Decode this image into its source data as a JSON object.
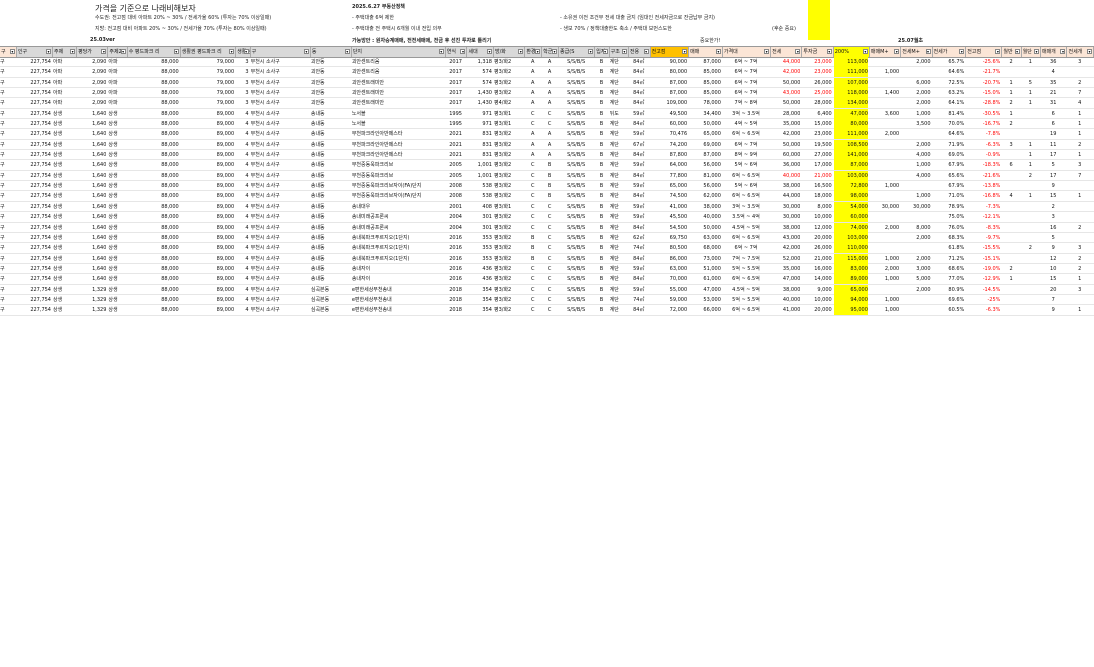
{
  "header_notes": {
    "title": "가격을 기준으로 나래비해보자",
    "line1": "수도권: 전고점 대비 아파트 20% ~ 30% / 전세가율 60% (투자는 70% 이상일때)",
    "line2": "지방: 전고점 대비 아파트 20% ~ 30% / 전세가율 70% (투자는 80% 이상일때)",
    "date": "2025.6.27 부동산정책",
    "policy1": "- 주택대출 6억 제한",
    "policy2": "- 주택대출 전 주택시 6개월 이내 전입 의무",
    "policy3": "- 소유권 이전 조건부 전세 대출 금지 (임대인 전세자금으로 잔금납부 금지)",
    "policy4": "- 생보 70% / 정책대출한도 축소 / 주택대 보먼스도한",
    "policy5": "(후순 중요)",
    "left_marker": "25.03ver",
    "mid_marker": "가능방안 : 원자승계매매, 전전세매매, 전금 후 선진 투자로 틀리기",
    "sell_label": "중요한가!",
    "right_marker": "25.07월초"
  },
  "columns": [
    {
      "label": "구",
      "style": "peach"
    },
    {
      "label": "인구",
      "style": "gray"
    },
    {
      "label": "주제",
      "style": "gray"
    },
    {
      "label": "평당가",
      "style": "gray"
    },
    {
      "label": "주제2",
      "style": "gray"
    },
    {
      "label": "수 평드파크 리",
      "style": "gray"
    },
    {
      "label": "생활권 평드파크 리",
      "style": "gray"
    },
    {
      "label": "생활권",
      "style": "gray"
    },
    {
      "label": "구",
      "style": "gray"
    },
    {
      "label": "동",
      "style": "gray"
    },
    {
      "label": "단지",
      "style": "gray"
    },
    {
      "label": "연식",
      "style": "gray"
    },
    {
      "label": "세대",
      "style": "gray"
    },
    {
      "label": "방/화",
      "style": "gray"
    },
    {
      "label": "환경",
      "style": "gray"
    },
    {
      "label": "학군",
      "style": "gray"
    },
    {
      "label": "종급(S",
      "style": "gray"
    },
    {
      "label": "입지",
      "style": "gray"
    },
    {
      "label": "구조",
      "style": "gray"
    },
    {
      "label": "전용",
      "style": "gray"
    },
    {
      "label": "전고점",
      "style": "orange"
    },
    {
      "label": "매매",
      "style": "peach"
    },
    {
      "label": "가격대",
      "style": "peach"
    },
    {
      "label": "전세",
      "style": "peach"
    },
    {
      "label": "투자금",
      "style": "peach"
    },
    {
      "label": "200%",
      "style": "yellow"
    },
    {
      "label": "매매M+",
      "style": "peach"
    },
    {
      "label": "전세M+",
      "style": "peach"
    },
    {
      "label": "전세가",
      "style": "peach"
    },
    {
      "label": "전고점",
      "style": "peach"
    },
    {
      "label": "월반",
      "style": "peach"
    },
    {
      "label": "월단",
      "style": "peach"
    },
    {
      "label": "매매개",
      "style": "peach"
    },
    {
      "label": "전세개",
      "style": "peach"
    }
  ],
  "rows": [
    [
      "구",
      "227,754",
      "아파",
      "2,090",
      "아파",
      "88,000",
      "79,000",
      "3",
      "부천시 소사구",
      "괴안동",
      "괴안센트리움",
      "2017",
      "1,318",
      "평3/화2",
      "A",
      "A",
      "S/S/B/S",
      "B",
      "계단",
      "84㎡",
      "90,000",
      "87,000",
      "6억 ~ 7억",
      "44,000",
      "23,000",
      "113,000",
      "",
      "2,000",
      "65.7%",
      "-25.6%",
      "2",
      "1",
      "36",
      "3"
    ],
    [
      "구",
      "227,754",
      "아파",
      "2,090",
      "아파",
      "88,000",
      "79,000",
      "3",
      "부천시 소사구",
      "괴안동",
      "괴안센트리움",
      "2017",
      "574",
      "평3/화2",
      "A",
      "A",
      "S/S/B/S",
      "B",
      "계단",
      "84㎡",
      "80,000",
      "85,000",
      "6억 ~ 7억",
      "42,000",
      "23,000",
      "111,000",
      "1,000",
      "",
      "64.6%",
      "-21.7%",
      "",
      "",
      "4",
      ""
    ],
    [
      "구",
      "227,754",
      "아파",
      "2,090",
      "아파",
      "88,000",
      "79,000",
      "3",
      "부천시 소사구",
      "괴안동",
      "괴안센트래미안",
      "2017",
      "574",
      "평3/화2",
      "A",
      "A",
      "S/S/B/S",
      "B",
      "계단",
      "84㎡",
      "87,000",
      "85,000",
      "6억 ~ 7억",
      "50,000",
      "26,000",
      "107,000",
      "",
      "6,000",
      "72.5%",
      "-20.7%",
      "1",
      "5",
      "35",
      "2"
    ],
    [
      "구",
      "227,754",
      "아파",
      "2,090",
      "아파",
      "88,000",
      "79,000",
      "3",
      "부천시 소사구",
      "괴안동",
      "괴안센트래미안",
      "2017",
      "1,430",
      "평3/화2",
      "A",
      "A",
      "S/S/B/S",
      "B",
      "계단",
      "84㎡",
      "87,000",
      "85,000",
      "6억 ~ 7억",
      "43,000",
      "25,000",
      "118,000",
      "1,400",
      "2,000",
      "63.2%",
      "-15.0%",
      "1",
      "1",
      "21",
      "7"
    ],
    [
      "구",
      "227,754",
      "아파",
      "2,090",
      "아파",
      "88,000",
      "79,000",
      "3",
      "부천시 소사구",
      "괴안동",
      "괴안센트래미안",
      "2017",
      "1,430",
      "평4/화2",
      "A",
      "A",
      "S/S/B/S",
      "B",
      "계단",
      "84㎡",
      "109,000",
      "78,000",
      "7억 ~ 8억",
      "50,000",
      "28,000",
      "134,000",
      "",
      "2,000",
      "64.1%",
      "-28.8%",
      "2",
      "1",
      "31",
      "4"
    ],
    [
      "구",
      "227,754",
      "상생",
      "1,640",
      "상생",
      "88,000",
      "89,000",
      "4",
      "부천시 소사구",
      "송내동",
      "노서블",
      "1995",
      "971",
      "평3/화1",
      "C",
      "C",
      "S/S/B/S",
      "B",
      "뒤도",
      "59㎡",
      "49,500",
      "34,400",
      "3억 ~ 3.5억",
      "28,000",
      "6,400",
      "47,000",
      "3,600",
      "1,000",
      "81.4%",
      "-30.5%",
      "1",
      "",
      "6",
      "1"
    ],
    [
      "구",
      "227,754",
      "상생",
      "1,640",
      "상생",
      "88,000",
      "89,000",
      "4",
      "부천시 소사구",
      "송내동",
      "노서블",
      "1995",
      "971",
      "평3/화1",
      "C",
      "C",
      "S/S/B/S",
      "B",
      "계단",
      "84㎡",
      "60,000",
      "50,000",
      "4억 ~ 5억",
      "35,000",
      "15,000",
      "80,000",
      "",
      "3,500",
      "70.0%",
      "-16.7%",
      "2",
      "",
      "6",
      "1"
    ],
    [
      "구",
      "227,754",
      "상생",
      "1,640",
      "상생",
      "88,000",
      "89,000",
      "4",
      "부천시 소사구",
      "송내동",
      "부천파크라인아반떼스타",
      "2021",
      "831",
      "평3/화2",
      "A",
      "A",
      "S/S/B/S",
      "B",
      "계단",
      "59㎡",
      "70,476",
      "65,000",
      "6억 ~ 6.5억",
      "42,000",
      "23,000",
      "111,000",
      "2,000",
      "",
      "64.6%",
      "-7.8%",
      "",
      "",
      "19",
      "1"
    ],
    [
      "구",
      "227,754",
      "상생",
      "1,640",
      "상생",
      "88,000",
      "89,000",
      "4",
      "부천시 소사구",
      "송내동",
      "부천파크라인아반떼스타",
      "2021",
      "831",
      "평3/화2",
      "A",
      "A",
      "S/S/B/S",
      "B",
      "계단",
      "67㎡",
      "74,200",
      "69,000",
      "6억 ~ 7억",
      "50,000",
      "19,500",
      "108,500",
      "",
      "2,000",
      "71.9%",
      "-6.3%",
      "3",
      "1",
      "11",
      "2"
    ],
    [
      "구",
      "227,754",
      "상생",
      "1,640",
      "상생",
      "88,000",
      "89,000",
      "4",
      "부천시 소사구",
      "송내동",
      "부천파크라인아반떼스타",
      "2021",
      "831",
      "평3/화2",
      "A",
      "A",
      "S/S/B/S",
      "B",
      "계단",
      "84㎡",
      "87,800",
      "87,000",
      "8억 ~ 9억",
      "60,000",
      "27,000",
      "141,000",
      "",
      "4,000",
      "69.0%",
      "-0.9%",
      "",
      "1",
      "17",
      "1"
    ],
    [
      "구",
      "227,754",
      "상생",
      "1,640",
      "상생",
      "88,000",
      "89,000",
      "4",
      "부천시 소사구",
      "송내동",
      "부천중동욱파크리브",
      "2005",
      "1,001",
      "평3/화2",
      "C",
      "B",
      "S/S/B/S",
      "B",
      "계단",
      "59㎡",
      "64,000",
      "56,000",
      "5억 ~ 6억",
      "36,000",
      "17,000",
      "87,000",
      "",
      "1,000",
      "67.9%",
      "-18.3%",
      "6",
      "1",
      "5",
      "3"
    ],
    [
      "구",
      "227,754",
      "상생",
      "1,640",
      "상생",
      "88,000",
      "89,000",
      "4",
      "부천시 소사구",
      "송내동",
      "부천중동욱파크리브",
      "2005",
      "1,001",
      "평3/화2",
      "C",
      "B",
      "S/S/B/S",
      "B",
      "계단",
      "84㎡",
      "77,800",
      "81,000",
      "6억 ~ 6.5억",
      "40,000",
      "21,000",
      "103,000",
      "",
      "4,000",
      "65.6%",
      "-21.6%",
      "",
      "2",
      "17",
      "7"
    ],
    [
      "구",
      "227,754",
      "상생",
      "1,640",
      "상생",
      "88,000",
      "89,000",
      "4",
      "부천시 소사구",
      "송내동",
      "부천중동욱파크리브자이(FA)단지",
      "2008",
      "538",
      "평3/화2",
      "C",
      "B",
      "S/S/B/S",
      "B",
      "계단",
      "59㎡",
      "65,000",
      "56,000",
      "5억 ~ 6억",
      "38,000",
      "16,500",
      "72,800",
      "1,000",
      "",
      "67.9%",
      "-13.8%",
      "",
      "",
      "9",
      ""
    ],
    [
      "구",
      "227,754",
      "상생",
      "1,640",
      "상생",
      "88,000",
      "89,000",
      "4",
      "부천시 소사구",
      "송내동",
      "부천중동욱파크리브자이(FA)단지",
      "2008",
      "538",
      "평3/화2",
      "C",
      "B",
      "S/S/B/S",
      "B",
      "계단",
      "84㎡",
      "74,500",
      "62,000",
      "6억 ~ 6.5억",
      "44,000",
      "18,000",
      "98,000",
      "",
      "1,000",
      "71.0%",
      "-16.8%",
      "4",
      "1",
      "15",
      "1"
    ],
    [
      "구",
      "227,754",
      "상생",
      "1,640",
      "상생",
      "88,000",
      "89,000",
      "4",
      "부천시 소사구",
      "송내동",
      "송내대우",
      "2001",
      "408",
      "평3/화1",
      "C",
      "C",
      "S/S/B/S",
      "B",
      "계단",
      "59㎡",
      "41,000",
      "38,000",
      "3억 ~ 3.5억",
      "30,000",
      "8,000",
      "54,000",
      "30,000",
      "30,000",
      "78.9%",
      "-7.3%",
      "",
      "",
      "2",
      ""
    ],
    [
      "구",
      "227,754",
      "상생",
      "1,640",
      "상생",
      "88,000",
      "89,000",
      "4",
      "부천시 소사구",
      "송내동",
      "송내미래공프론씨",
      "2004",
      "301",
      "평3/화2",
      "C",
      "C",
      "S/S/B/S",
      "B",
      "계단",
      "59㎡",
      "45,500",
      "40,000",
      "3.5억 ~ 4억",
      "30,000",
      "10,000",
      "60,000",
      "",
      "",
      "75.0%",
      "-12.1%",
      "",
      "",
      "3",
      ""
    ],
    [
      "구",
      "227,754",
      "상생",
      "1,640",
      "상생",
      "88,000",
      "89,000",
      "4",
      "부천시 소사구",
      "송내동",
      "송내미래공프론씨",
      "2004",
      "301",
      "평3/화2",
      "C",
      "C",
      "S/S/B/S",
      "B",
      "계단",
      "84㎡",
      "54,500",
      "50,000",
      "4.5억 ~ 5억",
      "38,000",
      "12,000",
      "74,000",
      "2,000",
      "8,000",
      "76.0%",
      "-8.3%",
      "",
      "",
      "16",
      "2"
    ],
    [
      "구",
      "227,754",
      "상생",
      "1,640",
      "상생",
      "88,000",
      "89,000",
      "4",
      "부천시 소사구",
      "송내동",
      "송내북파크푸르지오(1단지)",
      "2016",
      "353",
      "평3/화2",
      "B",
      "C",
      "S/S/B/S",
      "B",
      "계단",
      "62㎡",
      "69,750",
      "63,000",
      "6억 ~ 6.5억",
      "43,000",
      "20,000",
      "103,000",
      "",
      "2,000",
      "68.3%",
      "-9.7%",
      "",
      "",
      "5",
      ""
    ],
    [
      "구",
      "227,754",
      "상생",
      "1,640",
      "상생",
      "88,000",
      "89,000",
      "4",
      "부천시 소사구",
      "송내동",
      "송내북파크푸르지오(1단지)",
      "2016",
      "353",
      "평3/화2",
      "B",
      "C",
      "S/S/B/S",
      "B",
      "계단",
      "74㎡",
      "80,500",
      "68,000",
      "6억 ~ 7억",
      "42,000",
      "26,000",
      "110,000",
      "",
      "",
      "61.8%",
      "-15.5%",
      "",
      "2",
      "9",
      "3"
    ],
    [
      "구",
      "227,754",
      "상생",
      "1,640",
      "상생",
      "88,000",
      "89,000",
      "4",
      "부천시 소사구",
      "송내동",
      "송내북파크푸르지오(1단지)",
      "2016",
      "353",
      "평3/화2",
      "B",
      "C",
      "S/S/B/S",
      "B",
      "계단",
      "84㎡",
      "86,000",
      "73,000",
      "7억 ~ 7.5억",
      "52,000",
      "21,000",
      "115,000",
      "1,000",
      "2,000",
      "71.2%",
      "-15.1%",
      "",
      "",
      "12",
      "2"
    ],
    [
      "구",
      "227,754",
      "상생",
      "1,640",
      "상생",
      "88,000",
      "89,000",
      "4",
      "부천시 소사구",
      "송내동",
      "송내자이",
      "2016",
      "436",
      "평3/화2",
      "C",
      "C",
      "S/S/B/S",
      "B",
      "계단",
      "59㎡",
      "63,000",
      "51,000",
      "5억 ~ 5.5억",
      "35,000",
      "16,000",
      "83,000",
      "2,000",
      "3,000",
      "68.6%",
      "-19.0%",
      "2",
      "",
      "10",
      "2"
    ],
    [
      "구",
      "227,754",
      "상생",
      "1,640",
      "상생",
      "88,000",
      "89,000",
      "4",
      "부천시 소사구",
      "송내동",
      "송내자이",
      "2016",
      "436",
      "평3/화2",
      "C",
      "C",
      "S/S/B/S",
      "B",
      "계단",
      "84㎡",
      "70,000",
      "61,000",
      "6억 ~ 6.5억",
      "47,000",
      "14,000",
      "89,000",
      "1,000",
      "5,000",
      "77.0%",
      "-12.9%",
      "1",
      "",
      "15",
      "1"
    ],
    [
      "구",
      "227,754",
      "상생",
      "1,329",
      "상생",
      "88,000",
      "89,000",
      "4",
      "부천시 소사구",
      "심곡본동",
      "e편한세상부천송내",
      "2018",
      "354",
      "평3/화2",
      "C",
      "C",
      "S/S/B/S",
      "B",
      "계단",
      "59㎡",
      "55,000",
      "47,000",
      "4.5억 ~ 5억",
      "38,000",
      "9,000",
      "65,000",
      "",
      "2,000",
      "80.9%",
      "-14.5%",
      "",
      "",
      "20",
      "3"
    ],
    [
      "구",
      "227,754",
      "상생",
      "1,329",
      "상생",
      "88,000",
      "89,000",
      "4",
      "부천시 소사구",
      "심곡본동",
      "e편한세상부천송내",
      "2018",
      "354",
      "평3/화2",
      "C",
      "C",
      "S/S/B/S",
      "B",
      "계단",
      "74㎡",
      "59,000",
      "53,000",
      "5억 ~ 5.5억",
      "40,000",
      "10,000",
      "94,000",
      "1,000",
      "",
      "69.6%",
      "-25%",
      "",
      "",
      "7",
      ""
    ],
    [
      "구",
      "227,754",
      "상생",
      "1,329",
      "상생",
      "88,000",
      "89,000",
      "4",
      "부천시 소사구",
      "심곡본동",
      "e편한세상부천송내",
      "2018",
      "354",
      "평3/화2",
      "C",
      "C",
      "S/S/B/S",
      "B",
      "계단",
      "84㎡",
      "72,000",
      "66,000",
      "6억 ~ 6.5억",
      "41,000",
      "20,000",
      "95,000",
      "1,000",
      "",
      "60.5%",
      "-6.3%",
      "",
      "",
      "9",
      "1"
    ]
  ]
}
